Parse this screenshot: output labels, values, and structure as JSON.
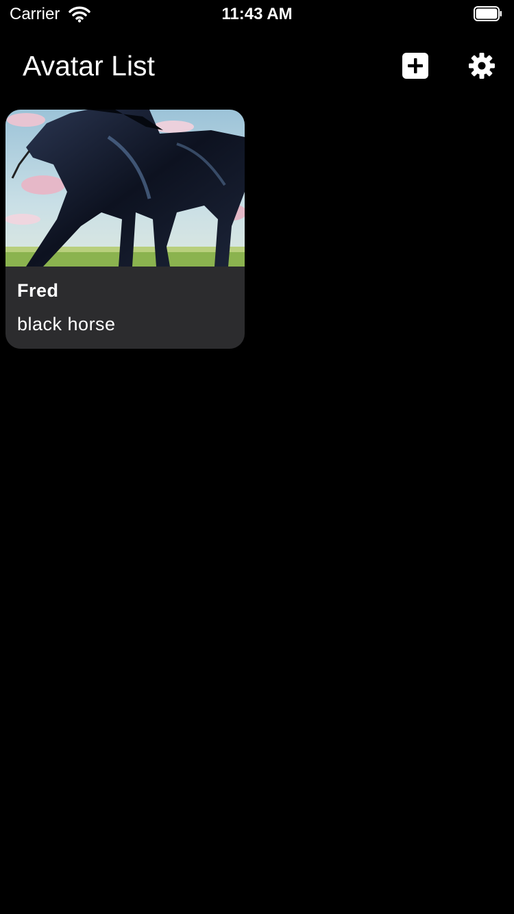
{
  "status_bar": {
    "carrier": "Carrier",
    "time": "11:43 AM",
    "icons": [
      "wifi-icon",
      "battery-icon"
    ]
  },
  "nav": {
    "title": "Avatar List",
    "icons": [
      "plus-square-icon",
      "gear-icon"
    ]
  },
  "avatars": [
    {
      "name": "Fred",
      "description": "black horse",
      "image": "black-horse-photo"
    }
  ],
  "colors": {
    "background": "#000000",
    "card": "#2c2c2e",
    "text": "#ffffff"
  }
}
